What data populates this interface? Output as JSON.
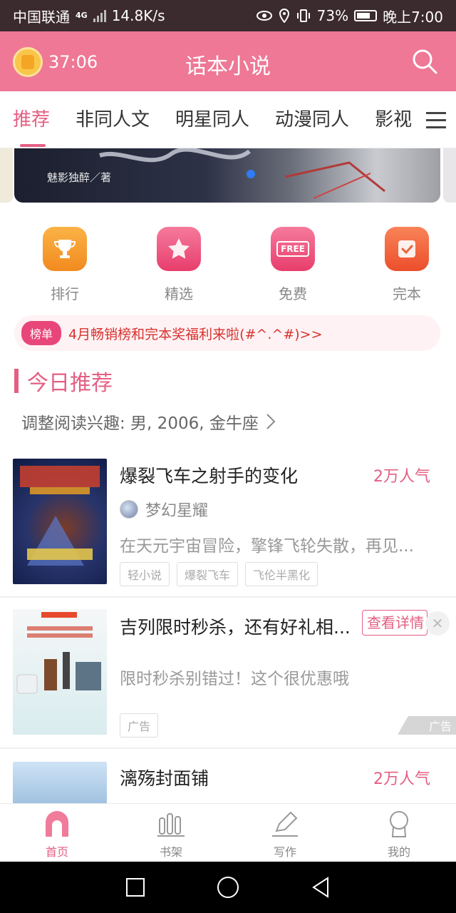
{
  "status_bar": {
    "carrier": "中国联通",
    "network": "4G",
    "speed": "14.8K/s",
    "battery": "73%",
    "time": "晚上7:00"
  },
  "app_bar": {
    "timer": "37:06",
    "title": "话本小说",
    "icons": [
      "clock-icon",
      "search-icon"
    ]
  },
  "tabs": [
    {
      "label": "推荐",
      "active": true
    },
    {
      "label": "非同人文"
    },
    {
      "label": "明星同人"
    },
    {
      "label": "动漫同人"
    },
    {
      "label": "影视"
    }
  ],
  "banner": {
    "author": "魅影独醉／著"
  },
  "quick_entries": [
    {
      "label": "排行",
      "icon": "trophy-icon",
      "color": "#f59a2c"
    },
    {
      "label": "精选",
      "icon": "star-icon",
      "color": "#ef4f7b"
    },
    {
      "label": "免费",
      "icon": "free-icon",
      "color": "#ef4f7b",
      "icon_text": "FREE"
    },
    {
      "label": "完本",
      "icon": "check-icon",
      "color": "#f0613a"
    }
  ],
  "notice": {
    "badge": "榜单",
    "text": "4月畅销榜和完本奖福利来啦(#^.^#)>>"
  },
  "section": {
    "title": "今日推荐",
    "interest": "调整阅读兴趣: 男, 2006, 金牛座"
  },
  "items": [
    {
      "title": "爆裂飞车之射手的变化",
      "popularity": "2万人气",
      "author": "梦幻星耀",
      "description": "在天元宇宙冒险，擎锋飞轮失散，再见...",
      "tags": [
        "轻小说",
        "爆裂飞车",
        "飞伦半黑化"
      ]
    },
    {
      "title": "吉列限时秒杀，还有好礼相...",
      "button": "查看详情",
      "description": "限时秒杀别错过！这个很优惠哦",
      "tags": [
        "广告"
      ],
      "ad_label": "广告"
    },
    {
      "title": "漓殇封面铺",
      "popularity": "2万人气"
    }
  ],
  "bottom_nav": [
    {
      "label": "首页",
      "icon": "home-icon",
      "active": true
    },
    {
      "label": "书架",
      "icon": "bookshelf-icon"
    },
    {
      "label": "写作",
      "icon": "pen-icon"
    },
    {
      "label": "我的",
      "icon": "profile-icon"
    }
  ],
  "colors": {
    "accent": "#e45f83",
    "header": "#ee7895",
    "status_bar": "#3b2a2e"
  }
}
